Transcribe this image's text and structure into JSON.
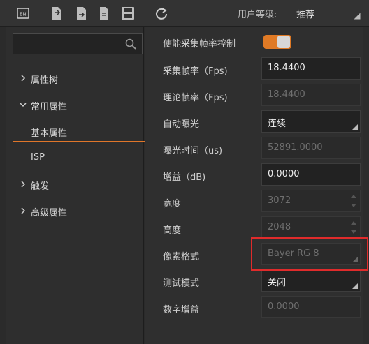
{
  "toolbar": {
    "icons": [
      "language-en-icon",
      "import-icon",
      "export-icon",
      "file-icon",
      "save-icon",
      "refresh-icon"
    ],
    "user_level_label": "用户等级:",
    "user_level_value": "推荐"
  },
  "tree": {
    "search_placeholder": "",
    "items": [
      {
        "label": "属性树",
        "expanded": false
      },
      {
        "label": "常用属性",
        "expanded": true
      },
      {
        "label": "基本属性",
        "selected": true
      },
      {
        "label": "ISP"
      },
      {
        "label": "触发",
        "expanded": false
      },
      {
        "label": "高级属性",
        "expanded": false
      }
    ]
  },
  "properties": [
    {
      "label": "使能采集帧率控制",
      "type": "toggle",
      "on": true
    },
    {
      "label": "采集帧率（Fps)",
      "type": "text",
      "value": "18.4400"
    },
    {
      "label": "理论帧率（Fps)",
      "type": "text",
      "value": "18.4400",
      "disabled": true
    },
    {
      "label": "自动曝光",
      "type": "select",
      "value": "连续"
    },
    {
      "label": "曝光时间（us)",
      "type": "text",
      "value": "52891.0000",
      "disabled": true
    },
    {
      "label": "增益（dB)",
      "type": "text",
      "value": "0.0000"
    },
    {
      "label": "宽度",
      "type": "spin",
      "value": "3072",
      "disabled": true
    },
    {
      "label": "高度",
      "type": "spin",
      "value": "2048",
      "disabled": true
    },
    {
      "label": "像素格式",
      "type": "select",
      "value": "Bayer RG 8",
      "disabled": true
    },
    {
      "label": "测试模式",
      "type": "select",
      "value": "关闭"
    },
    {
      "label": "数字增益",
      "type": "text",
      "value": "0.0000",
      "disabled": true
    }
  ],
  "colors": {
    "accent": "#e07a25",
    "highlight": "#e02b2b"
  }
}
